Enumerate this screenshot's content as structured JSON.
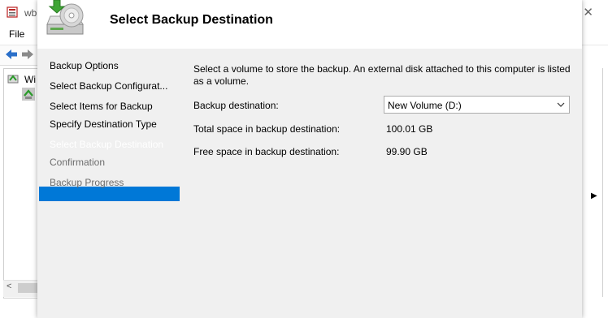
{
  "background_window": {
    "title": "wb",
    "close_glyph": "✕",
    "menu_file": "File",
    "tree_item_label": "Wi",
    "scroll_left_glyph": "<",
    "right_arrow_glyph": "▶"
  },
  "wizard": {
    "title": "Select Backup Destination",
    "steps": [
      {
        "label": "Backup Options",
        "state": "normal"
      },
      {
        "label": "Select Backup Configurat...",
        "state": "normal"
      },
      {
        "label": "Select Items for Backup",
        "state": "normal"
      },
      {
        "label": "Specify Destination Type",
        "state": "normal"
      },
      {
        "label": "Select Backup Destination",
        "state": "active"
      },
      {
        "label": "Confirmation",
        "state": "disabled"
      },
      {
        "label": "Backup Progress",
        "state": "disabled"
      }
    ],
    "instruction": "Select a volume to store the backup. An external disk attached to this computer is listed as a volume.",
    "destination_label": "Backup destination:",
    "destination_value": "New Volume (D:)",
    "total_space_label": "Total space in backup destination:",
    "total_space_value": "100.01 GB",
    "free_space_label": "Free space in backup destination:",
    "free_space_value": "99.90 GB"
  },
  "colors": {
    "active_step": "#0078d7",
    "dialog_bg": "#f0f0f0",
    "disabled_text": "#6d6d6d"
  },
  "icons": [
    "app-icon",
    "back-arrow-icon",
    "forward-arrow-icon",
    "backup-tree-icon",
    "backup-drive-icon",
    "chevron-down-icon",
    "close-icon"
  ]
}
